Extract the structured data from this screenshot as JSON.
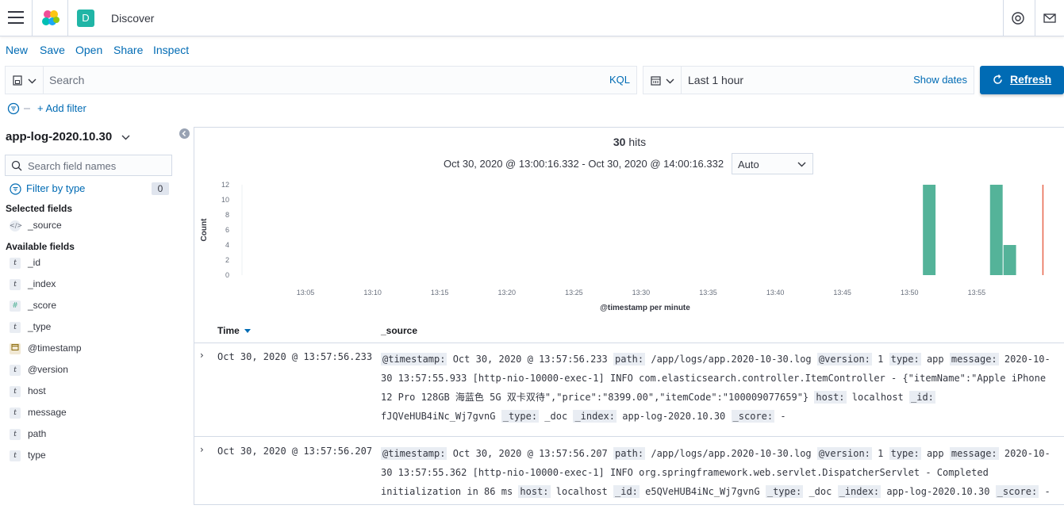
{
  "topbar": {
    "space_initial": "D",
    "app_title": "Discover"
  },
  "menu": {
    "items": [
      "New",
      "Save",
      "Open",
      "Share",
      "Inspect"
    ]
  },
  "query": {
    "placeholder": "Search",
    "language": "KQL"
  },
  "date": {
    "range_label": "Last 1 hour",
    "show_dates": "Show dates"
  },
  "refresh_label": "Refresh",
  "filter": {
    "add_label": "+ Add filter"
  },
  "sidebar": {
    "index_pattern": "app-log-2020.10.30",
    "search_placeholder": "Search field names",
    "filter_by_type": "Filter by type",
    "filter_count": "0",
    "selected_title": "Selected fields",
    "selected": [
      {
        "name": "_source",
        "type": "source"
      }
    ],
    "available_title": "Available fields",
    "available": [
      {
        "name": "_id",
        "type": "t"
      },
      {
        "name": "_index",
        "type": "t"
      },
      {
        "name": "_score",
        "type": "#"
      },
      {
        "name": "_type",
        "type": "t"
      },
      {
        "name": "@timestamp",
        "type": "date"
      },
      {
        "name": "@version",
        "type": "t"
      },
      {
        "name": "host",
        "type": "t"
      },
      {
        "name": "message",
        "type": "t"
      },
      {
        "name": "path",
        "type": "t"
      },
      {
        "name": "type",
        "type": "t"
      }
    ]
  },
  "main": {
    "hits_count": "30",
    "hits_label": "hits",
    "time_range": "Oct 30, 2020 @ 13:00:16.332 - Oct 30, 2020 @ 14:00:16.332",
    "interval": "Auto"
  },
  "chart_data": {
    "type": "bar",
    "xlabel": "@timestamp per minute",
    "ylabel": "Count",
    "yticks": [
      0,
      2,
      4,
      6,
      8,
      10,
      12
    ],
    "ylim": [
      0,
      12
    ],
    "xticks": [
      "13:05",
      "13:10",
      "13:15",
      "13:20",
      "13:25",
      "13:30",
      "13:35",
      "13:40",
      "13:45",
      "13:50",
      "13:55"
    ],
    "bars": [
      {
        "minute": "13:51",
        "value": 12
      },
      {
        "minute": "13:56",
        "value": 12
      },
      {
        "minute": "13:57",
        "value": 4
      }
    ],
    "bar_color": "#54b399",
    "now_marker": "14:00"
  },
  "table": {
    "col_time": "Time",
    "col_source": "_source",
    "rows": [
      {
        "time": "Oct 30, 2020 @ 13:57:56.233",
        "fields": [
          [
            "@timestamp:",
            "Oct 30, 2020 @ 13:57:56.233"
          ],
          [
            "path:",
            "/app/logs/app.2020-10-30.log"
          ],
          [
            "@version:",
            "1"
          ],
          [
            "type:",
            "app"
          ],
          [
            "message:",
            "2020-10-30 13:57:55.933 [http-nio-10000-exec-1] INFO com.elasticsearch.controller.ItemController - {\"itemName\":\"Apple iPhone 12 Pro 128GB 海蓝色 5G 双卡双待\",\"price\":\"8399.00\",\"itemCode\":\"100009077659\"}"
          ],
          [
            "host:",
            "localhost"
          ],
          [
            "_id:",
            "fJQVeHUB4iNc_Wj7gvnG"
          ],
          [
            "_type:",
            "_doc"
          ],
          [
            "_index:",
            "app-log-2020.10.30"
          ],
          [
            "_score:",
            " -"
          ]
        ]
      },
      {
        "time": "Oct 30, 2020 @ 13:57:56.207",
        "fields": [
          [
            "@timestamp:",
            "Oct 30, 2020 @ 13:57:56.207"
          ],
          [
            "path:",
            "/app/logs/app.2020-10-30.log"
          ],
          [
            "@version:",
            "1"
          ],
          [
            "type:",
            "app"
          ],
          [
            "message:",
            "2020-10-30 13:57:55.362 [http-nio-10000-exec-1] INFO org.springframework.web.servlet.DispatcherServlet - Completed initialization in 86 ms"
          ],
          [
            "host:",
            "localhost"
          ],
          [
            "_id:",
            "e5QVeHUB4iNc_Wj7gvnG"
          ],
          [
            "_type:",
            "_doc"
          ],
          [
            "_index:",
            "app-log-2020.10.30"
          ],
          [
            "_score:",
            " -"
          ]
        ]
      }
    ]
  }
}
